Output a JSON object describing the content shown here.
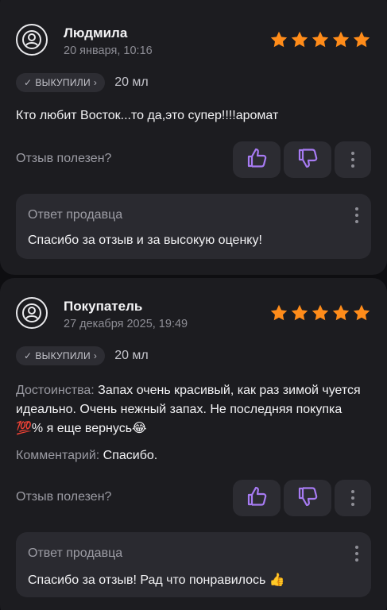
{
  "reviews": [
    {
      "author": "Людмила",
      "date": "20 января, 10:16",
      "rating": 5,
      "badge": "ВЫКУПИЛИ",
      "volume": "20 мл",
      "text": "Кто любит Восток...то да,это супер!!!!аромат",
      "helpful_label": "Отзыв полезен?",
      "reply": {
        "title": "Ответ продавца",
        "text": "Спасибо за отзыв и за высокую оценку!"
      }
    },
    {
      "author": "Покупатель",
      "date": "27 декабря 2025, 19:49",
      "rating": 5,
      "badge": "ВЫКУПИЛИ",
      "volume": "20 мл",
      "pros_label": "Достоинства:",
      "pros_text": " Запах очень красивый, как раз зимой чуется идеально. Очень нежный запах. Не последняя покупка 💯% я еще вернусь😂",
      "comment_label": "Комментарий:",
      "comment_text": " Спасибо.",
      "helpful_label": "Отзыв полезен?",
      "reply": {
        "title": "Ответ продавца",
        "text": "Спасибо за отзыв!  Рад что понравилось 👍"
      }
    }
  ],
  "colors": {
    "star": "#ff8c1a",
    "vote_icon": "#a77bf3",
    "card_bg": "#1c1c20",
    "page_bg": "#0e0e11"
  },
  "icons": {
    "avatar": "user-circle-icon",
    "like": "thumbs-up-icon",
    "dislike": "thumbs-down-icon",
    "more": "more-vertical-icon",
    "check": "check-icon",
    "chevron": "chevron-right-icon",
    "star": "star-icon"
  }
}
